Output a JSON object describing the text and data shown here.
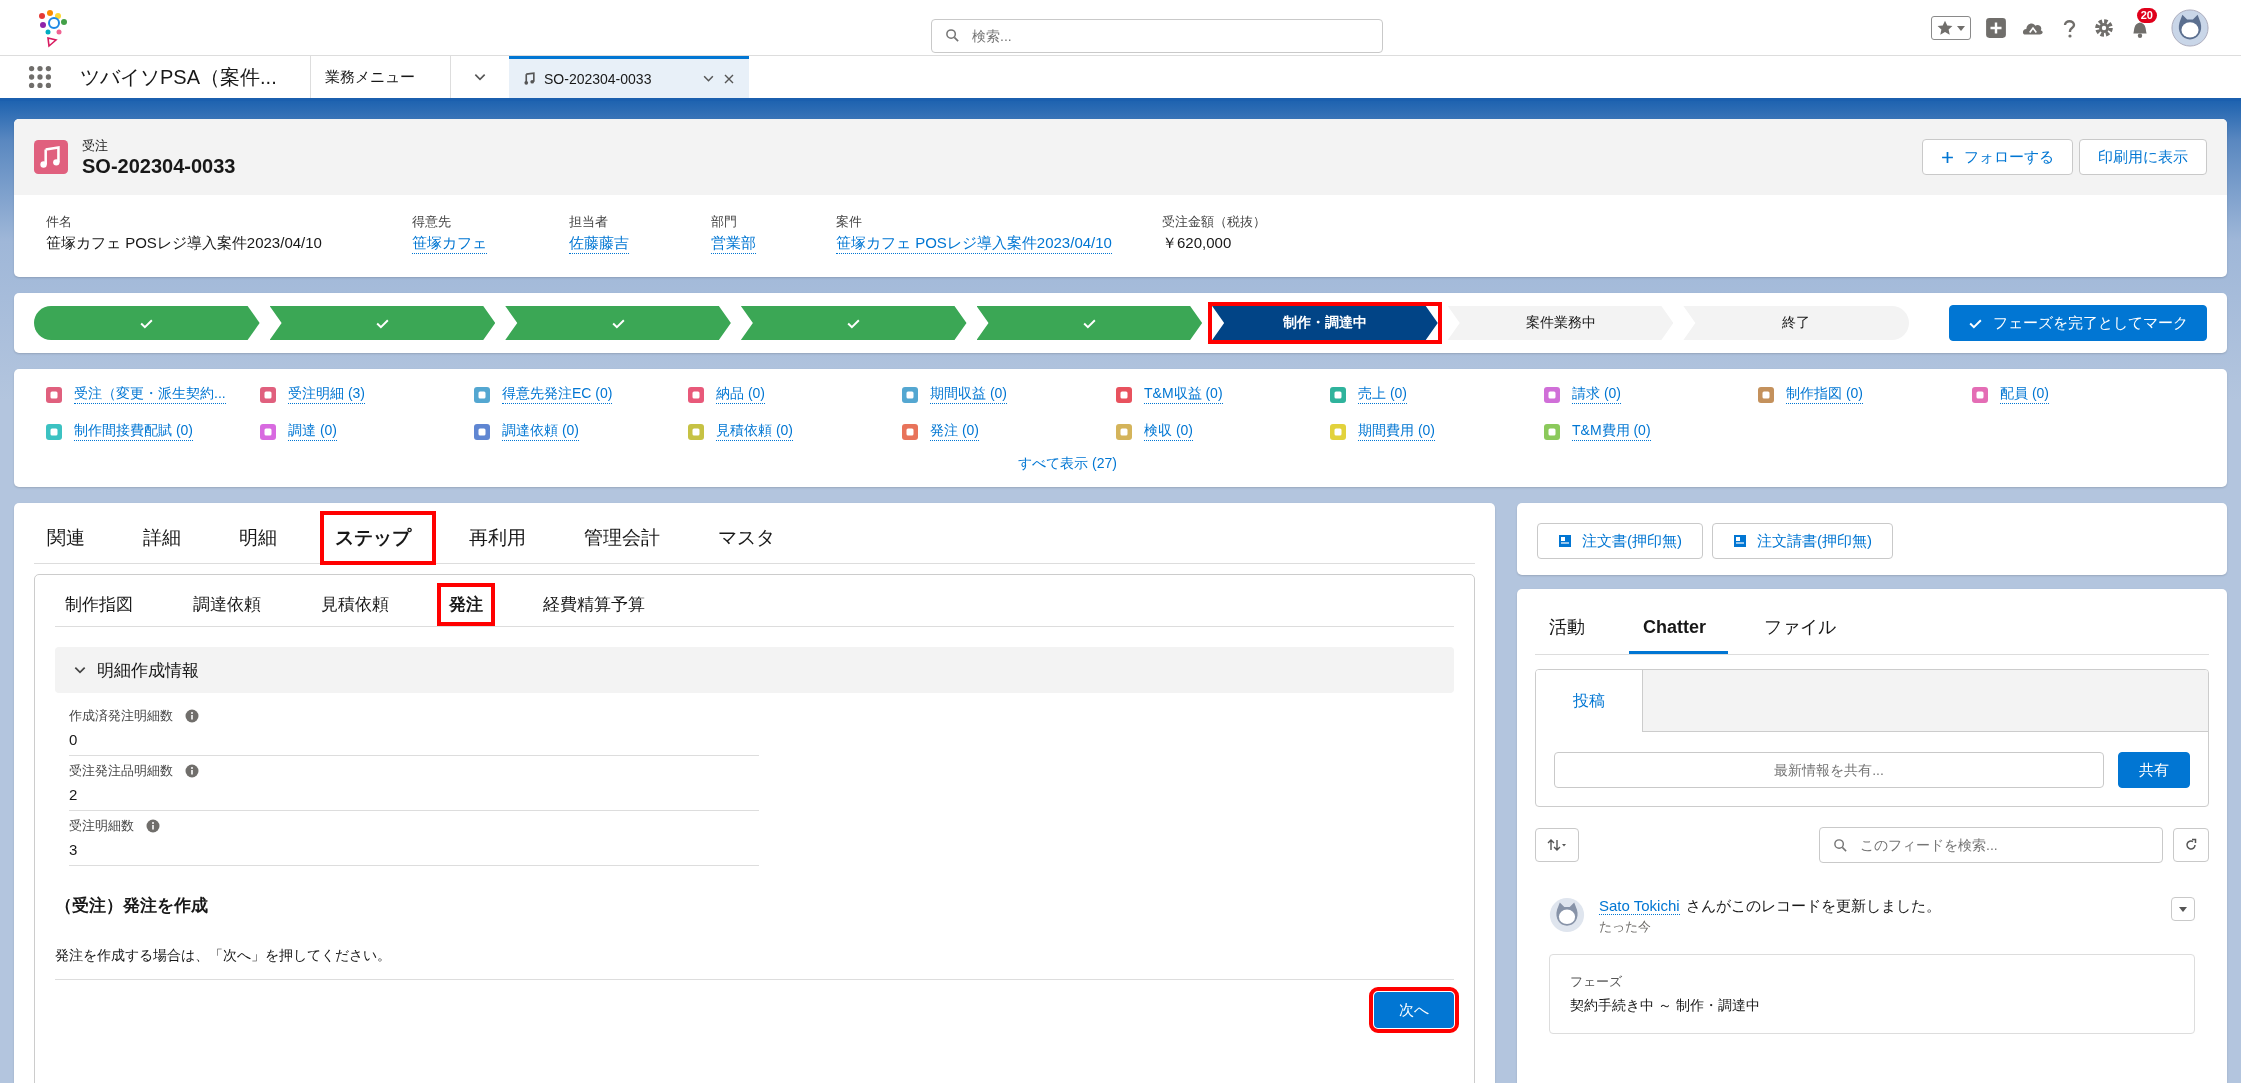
{
  "top_bar": {
    "search": {
      "placeholder": "検索..."
    },
    "notification_count": "20"
  },
  "nav": {
    "app_name": "ツバイソPSA（案件...",
    "menu": "業務メニュー",
    "tabs": [
      {
        "label": "SO-202304-0033",
        "selected": true
      }
    ]
  },
  "record": {
    "object_type": "受注",
    "title": "SO-202304-0033",
    "actions": [
      {
        "label": "フォローする",
        "kind": "follow"
      },
      {
        "label": "印刷用に表示",
        "kind": "plain"
      }
    ],
    "fields": [
      {
        "label": "件名",
        "value": "笹塚カフェ POSレジ導入案件2023/04/10",
        "kind": "text"
      },
      {
        "label": "得意先",
        "value": "笹塚カフェ",
        "kind": "link"
      },
      {
        "label": "担当者",
        "value": "佐藤藤吉",
        "kind": "link"
      },
      {
        "label": "部門",
        "value": "営業部",
        "kind": "link"
      },
      {
        "label": "案件",
        "value": "笹塚カフェ POSレジ導入案件2023/04/10",
        "kind": "link"
      },
      {
        "label": "受注金額（税抜）",
        "value": "￥620,000",
        "kind": "text"
      }
    ]
  },
  "path": {
    "steps": [
      {
        "complete": true,
        "current": false,
        "highlighted": false
      },
      {
        "complete": true,
        "current": false,
        "highlighted": false
      },
      {
        "complete": true,
        "current": false,
        "highlighted": false
      },
      {
        "complete": true,
        "current": false,
        "highlighted": false
      },
      {
        "complete": true,
        "current": false,
        "highlighted": false
      },
      {
        "label": "制作・調達中",
        "complete": false,
        "current": true,
        "highlighted": true
      },
      {
        "label": "案件業務中",
        "complete": false,
        "current": false,
        "highlighted": false
      },
      {
        "label": "終了",
        "complete": false,
        "current": false,
        "highlighted": false
      }
    ],
    "mark_button": "フェーズを完了としてマーク"
  },
  "related": {
    "items": [
      {
        "label": "受注（変更・派生契約...",
        "color": "#e0607e"
      },
      {
        "label": "受注明細 (3)",
        "color": "#e0607e"
      },
      {
        "label": "得意先発注EC (0)",
        "color": "#54a7d1"
      },
      {
        "label": "納品 (0)",
        "color": "#e8597a"
      },
      {
        "label": "期間収益 (0)",
        "color": "#54a7d1"
      },
      {
        "label": "T&M収益 (0)",
        "color": "#e8525e"
      },
      {
        "label": "売上 (0)",
        "color": "#2fb39c"
      },
      {
        "label": "請求 (0)",
        "color": "#d06fd8"
      },
      {
        "label": "制作指図 (0)",
        "color": "#c4915c"
      },
      {
        "label": "配員 (0)",
        "color": "#e46db5"
      },
      {
        "label": "制作間接費配賦 (0)",
        "color": "#3cc2c2"
      },
      {
        "label": "調達 (0)",
        "color": "#d86ae0"
      },
      {
        "label": "調達依頼 (0)",
        "color": "#5f86d2"
      },
      {
        "label": "見積依頼 (0)",
        "color": "#c6c244"
      },
      {
        "label": "発注 (0)",
        "color": "#e8735a"
      },
      {
        "label": "検収 (0)",
        "color": "#d4b45b"
      },
      {
        "label": "期間費用 (0)",
        "color": "#e2d23c"
      },
      {
        "label": "T&M費用 (0)",
        "color": "#8bc95b"
      }
    ],
    "show_all": "すべて表示 (27)"
  },
  "main_tabs": [
    {
      "label": "関連",
      "selected": false,
      "highlighted": false
    },
    {
      "label": "詳細",
      "selected": false,
      "highlighted": false
    },
    {
      "label": "明細",
      "selected": false,
      "highlighted": false
    },
    {
      "label": "ステップ",
      "selected": true,
      "highlighted": true
    },
    {
      "label": "再利用",
      "selected": false,
      "highlighted": false
    },
    {
      "label": "管理会計",
      "selected": false,
      "highlighted": false
    },
    {
      "label": "マスタ",
      "selected": false,
      "highlighted": false
    }
  ],
  "sub_tabs": [
    {
      "label": "制作指図",
      "selected": false,
      "highlighted": false
    },
    {
      "label": "調達依頼",
      "selected": false,
      "highlighted": false
    },
    {
      "label": "見積依頼",
      "selected": false,
      "highlighted": false
    },
    {
      "label": "発注",
      "selected": true,
      "highlighted": true
    },
    {
      "label": "経費精算予算",
      "selected": false,
      "highlighted": false
    }
  ],
  "section": {
    "title": "明細作成情報",
    "expanded": true,
    "fields": [
      {
        "label": "作成済発注明細数",
        "value": "0"
      },
      {
        "label": "受注発注品明細数",
        "value": "2"
      },
      {
        "label": "受注明細数",
        "value": "3"
      }
    ]
  },
  "create": {
    "heading": "（受注）発注を作成",
    "text": "発注を作成する場合は、「次へ」を押してください。",
    "button": {
      "label": "次へ",
      "highlighted": true
    }
  },
  "doc_buttons": [
    "注文書(押印無)",
    "注文請書(押印無)"
  ],
  "feed_tabs": [
    {
      "label": "活動",
      "selected": false
    },
    {
      "label": "Chatter",
      "selected": true
    },
    {
      "label": "ファイル",
      "selected": false
    }
  ],
  "publisher": {
    "tab": "投稿",
    "placeholder": "最新情報を共有...",
    "button": "共有"
  },
  "feed_search": {
    "placeholder": "このフィードを検索..."
  },
  "feed_item": {
    "author": "Sato Tokichi",
    "text": "さんがこのレコードを更新しました。",
    "time": "たった今",
    "change_label": "フェーズ",
    "change_value": "契約手続き中 ～ 制作・調達中"
  }
}
